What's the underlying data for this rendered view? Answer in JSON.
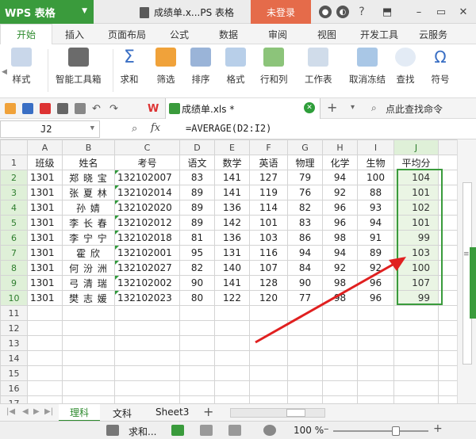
{
  "app": {
    "name": "WPS 表格",
    "doc_title": "成绩单.x...PS 表格",
    "login": "未登录"
  },
  "tabs": [
    "开始",
    "插入",
    "页面布局",
    "公式",
    "数据",
    "审阅",
    "视图",
    "开发工具",
    "云服务"
  ],
  "ribbon": [
    "样式",
    "智能工具箱",
    "求和",
    "筛选",
    "排序",
    "格式",
    "行和列",
    "工作表",
    "取消冻结",
    "查找",
    "符号"
  ],
  "file_tab": "成绩单.xls *",
  "search_command": "点此查找命令",
  "name_box": "J2",
  "fx": "fx",
  "formula": "=AVERAGE(D2:I2)",
  "columns": [
    "A",
    "B",
    "C",
    "D",
    "E",
    "F",
    "G",
    "H",
    "I",
    "J"
  ],
  "header_row": [
    "班级",
    "姓名",
    "考号",
    "语文",
    "数学",
    "英语",
    "物理",
    "化学",
    "生物",
    "平均分"
  ],
  "rows": [
    [
      "1301",
      "郑 晓 宝",
      "132102007",
      "83",
      "141",
      "127",
      "79",
      "94",
      "100",
      "104"
    ],
    [
      "1301",
      "张 夏 林",
      "132102014",
      "89",
      "141",
      "119",
      "76",
      "92",
      "88",
      "101"
    ],
    [
      "1301",
      "孙    婧",
      "132102020",
      "89",
      "136",
      "114",
      "82",
      "96",
      "93",
      "102"
    ],
    [
      "1301",
      "李 长 春",
      "132102012",
      "89",
      "142",
      "101",
      "83",
      "96",
      "94",
      "101"
    ],
    [
      "1301",
      "李 宁 宁",
      "132102018",
      "81",
      "136",
      "103",
      "86",
      "98",
      "91",
      "99"
    ],
    [
      "1301",
      "霍    欣",
      "132102001",
      "95",
      "131",
      "116",
      "94",
      "94",
      "89",
      "103"
    ],
    [
      "1301",
      "何 汾 洲",
      "132102027",
      "82",
      "140",
      "107",
      "84",
      "92",
      "92",
      "100"
    ],
    [
      "1301",
      "弓 清 瑞",
      "132102002",
      "90",
      "141",
      "128",
      "90",
      "98",
      "96",
      "107"
    ],
    [
      "1301",
      "樊 志 媛",
      "132102023",
      "80",
      "122",
      "120",
      "77",
      "98",
      "96",
      "99"
    ]
  ],
  "row_numbers": [
    "1",
    "2",
    "3",
    "4",
    "5",
    "6",
    "7",
    "8",
    "9",
    "10",
    "11",
    "12",
    "13",
    "14",
    "15",
    "16",
    "17"
  ],
  "sheets": [
    "理科",
    "文科",
    "Sheet3"
  ],
  "status": {
    "sum_label": "求和...",
    "zoom": "100 %"
  },
  "colors": {
    "accent": "#3a9b3c",
    "login": "#e56b4a",
    "arrow": "#e02020"
  }
}
